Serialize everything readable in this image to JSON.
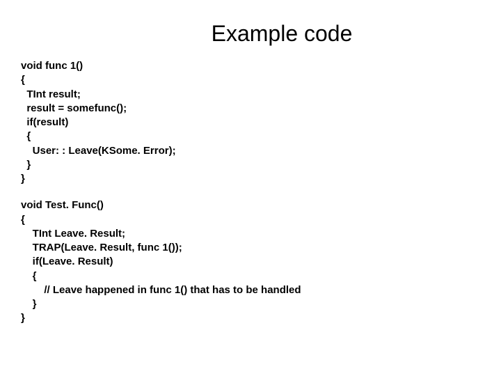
{
  "title": "Example code",
  "code1": "void func 1()\n{\n  TInt result;\n  result = somefunc();\n  if(result)\n  {\n    User: : Leave(KSome. Error);\n  }\n}",
  "code2": "void Test. Func()\n{\n    TInt Leave. Result;\n    TRAP(Leave. Result, func 1());\n    if(Leave. Result)\n    {\n        // Leave happened in func 1() that has to be handled\n    }\n}"
}
